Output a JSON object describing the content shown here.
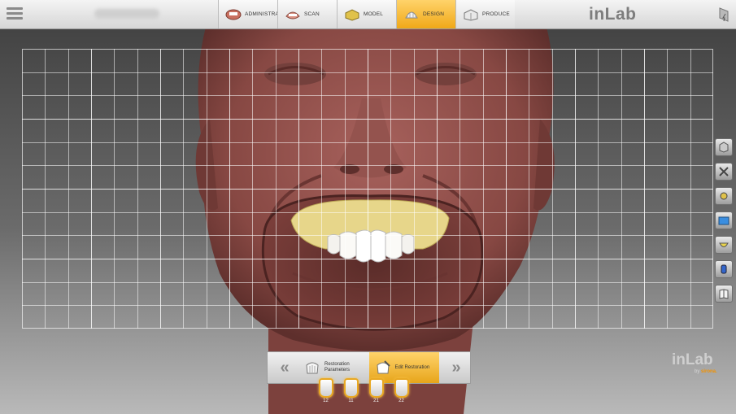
{
  "app": {
    "brand": "inLab",
    "watermark_name": "inLab",
    "watermark_sub_prefix": "by",
    "watermark_sub_brand": "sirona."
  },
  "workflow": {
    "steps": [
      {
        "label": "ADMINISTRATION",
        "icon": "administration-icon",
        "active": false
      },
      {
        "label": "SCAN",
        "icon": "scan-icon",
        "active": false
      },
      {
        "label": "MODEL",
        "icon": "model-icon",
        "active": false
      },
      {
        "label": "DESIGN",
        "icon": "design-icon",
        "active": true
      },
      {
        "label": "PRODUCE",
        "icon": "produce-icon",
        "active": false
      }
    ]
  },
  "tools": [
    "view-cube-icon",
    "tools-icon",
    "analysis-icon",
    "screenshot-icon",
    "smile-design-icon",
    "object-list-icon",
    "library-icon"
  ],
  "phases": {
    "prev_label": "«",
    "next_label": "»",
    "items": [
      {
        "label": "Restoration Parameters",
        "active": false
      },
      {
        "label": "Edit Restoration",
        "active": true
      }
    ]
  },
  "teeth": [
    "12",
    "11",
    "21",
    "22"
  ],
  "colors": {
    "accent": "#f0a818",
    "face": "#8a4b48",
    "teeth_prep": "#e8d88a"
  }
}
